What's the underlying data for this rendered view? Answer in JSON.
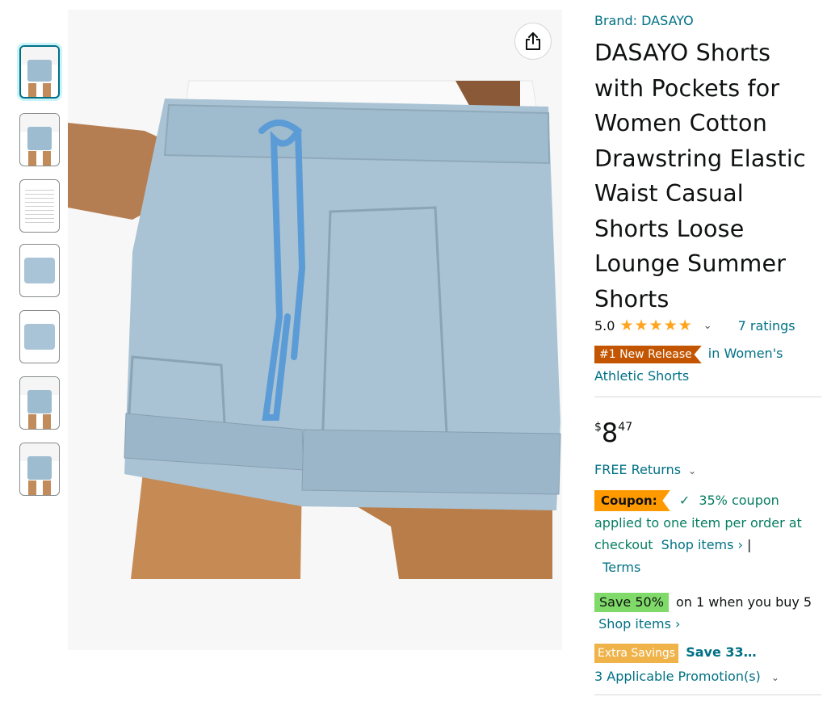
{
  "product": {
    "brand": "Brand: DASAYO",
    "title": "DASAYO Shorts with Pockets for Women Cotton Drawstring Elastic Waist Casual Shorts Loose Lounge Summer Shorts",
    "rating_value": "5.0",
    "stars": 5,
    "ratings_count": "7 ratings",
    "badge_label": "#1 New Release",
    "badge_category": "in Women's Athletic Shorts",
    "price_symbol": "$",
    "price_whole": "8",
    "price_fraction": "47",
    "returns": "FREE Returns",
    "coupon": {
      "label": "Coupon:",
      "check": "✓",
      "text": "35% coupon applied to one item per order at checkout",
      "shop_items": "Shop items ›",
      "separator": "|",
      "terms": "Terms"
    },
    "save": {
      "badge": "Save 50%",
      "text": "on 1 when you buy 5",
      "shop_items": "Shop items ›"
    },
    "extra": {
      "badge": "Extra Savings",
      "text": "Save 33…",
      "promotions": "3 Applicable Promotion(s)"
    }
  },
  "gallery": {
    "thumbnail_count": 7,
    "selected_index": 0,
    "share_icon": "share-icon"
  },
  "colors": {
    "link": "#007185",
    "star": "#ffa41c",
    "badge_release": "#c45500",
    "coupon": "#ff9900",
    "save": "#7fda69",
    "extra": "#efb34a",
    "green_text": "#067d62"
  }
}
